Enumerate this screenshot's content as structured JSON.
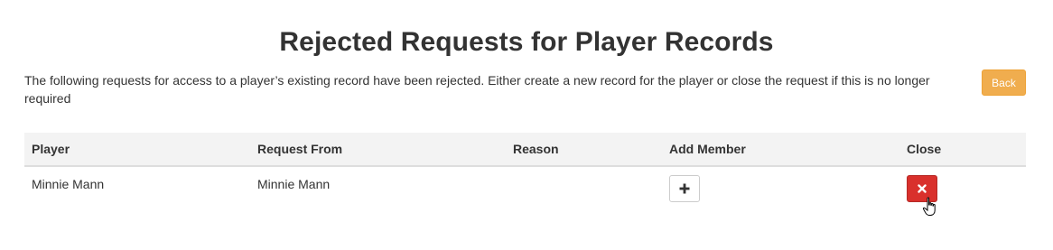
{
  "page": {
    "title": "Rejected Requests for Player Records",
    "description": "The following requests for access to a player’s existing record have been rejected. Either create a new record for the player or close the request if this is no longer required",
    "back_label": "Back"
  },
  "table": {
    "headers": {
      "player": "Player",
      "request_from": "Request From",
      "reason": "Reason",
      "add_member": "Add Member",
      "close": "Close"
    },
    "rows": [
      {
        "player": "Minnie Mann",
        "request_from": "Minnie Mann",
        "reason": "",
        "add_icon": "plus-icon",
        "close_icon": "close-icon"
      }
    ]
  },
  "colors": {
    "warning": "#f0ad4e",
    "danger": "#d9302c",
    "header_bg": "#f3f3f3"
  }
}
